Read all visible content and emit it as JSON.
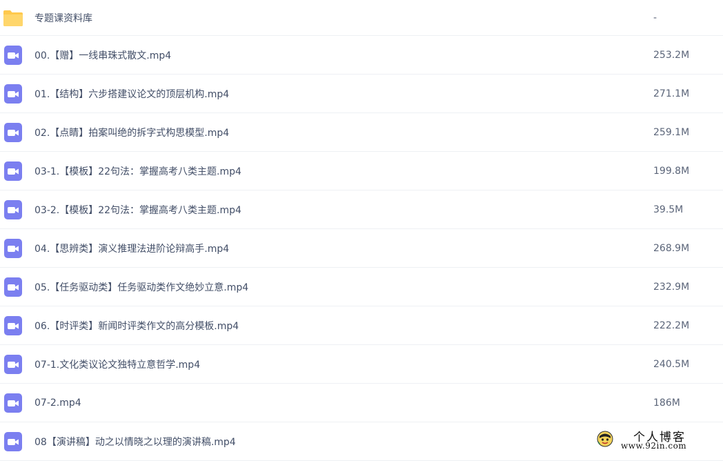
{
  "files": [
    {
      "name": "专题课资料库",
      "size": "-",
      "type": "folder"
    },
    {
      "name": "00.【赠】一线串珠式散文.mp4",
      "size": "253.2M",
      "type": "video"
    },
    {
      "name": "01.【结构】六步搭建议论文的顶层机构.mp4",
      "size": "271.1M",
      "type": "video"
    },
    {
      "name": "02.【点睛】拍案叫绝的拆字式构思模型.mp4",
      "size": "259.1M",
      "type": "video"
    },
    {
      "name": "03-1.【模板】22句法：掌握高考八类主题.mp4",
      "size": "199.8M",
      "type": "video"
    },
    {
      "name": "03-2.【模板】22句法：掌握高考八类主题.mp4",
      "size": "39.5M",
      "type": "video"
    },
    {
      "name": "04.【思辨类】演义推理法进阶论辩高手.mp4",
      "size": "268.9M",
      "type": "video"
    },
    {
      "name": "05.【任务驱动类】任务驱动类作文绝妙立意.mp4",
      "size": "232.9M",
      "type": "video"
    },
    {
      "name": "06.【时评类】新闻时评类作文的高分模板.mp4",
      "size": "222.2M",
      "type": "video"
    },
    {
      "name": "07-1.文化类议论文独特立意哲学.mp4",
      "size": "240.5M",
      "type": "video"
    },
    {
      "name": "07-2.mp4",
      "size": "186M",
      "type": "video"
    },
    {
      "name": "08【演讲稿】动之以情晓之以理的演讲稿.mp4",
      "size": "",
      "type": "video"
    }
  ],
  "watermark": {
    "title": "个人博客",
    "url": "www.92in.com"
  },
  "colors": {
    "folder": "#ffc94d",
    "video": "#7b7ff0",
    "divider": "#eef0f4"
  }
}
